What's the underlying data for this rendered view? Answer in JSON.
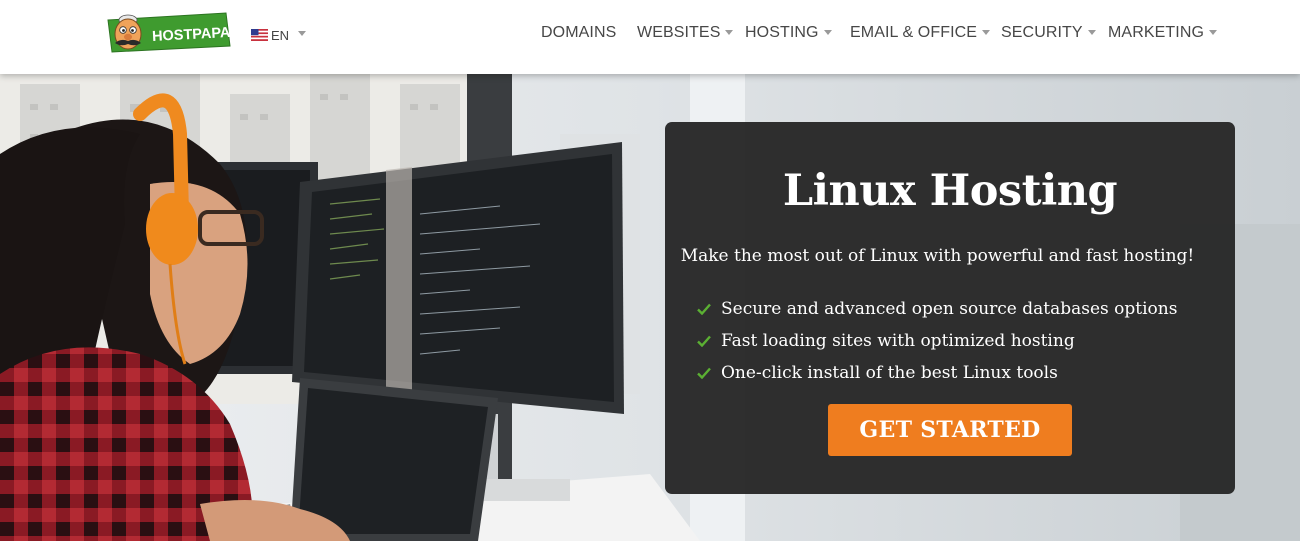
{
  "header": {
    "logo_text": "HOSTPAPA",
    "language": {
      "code": "EN",
      "flag": "us-flag-icon"
    },
    "nav": [
      {
        "label": "DOMAINS",
        "has_dropdown": false
      },
      {
        "label": "WEBSITES",
        "has_dropdown": true
      },
      {
        "label": "HOSTING",
        "has_dropdown": true
      },
      {
        "label": "EMAIL & OFFICE",
        "has_dropdown": true
      },
      {
        "label": "SECURITY",
        "has_dropdown": true
      },
      {
        "label": "MARKETING",
        "has_dropdown": true
      }
    ]
  },
  "hero": {
    "title": "Linux Hosting",
    "subtitle": "Make the most out of Linux with powerful and fast hosting!",
    "features": [
      "Secure and advanced open source databases options",
      "Fast loading sites with optimized hosting",
      "One-click install of the best Linux tools"
    ],
    "cta_label": "GET STARTED"
  },
  "colors": {
    "accent": "#ef7d1f",
    "brand_green": "#3f9b2f",
    "check_green": "#5bb033",
    "card_bg": "#282828",
    "nav_text": "#474747"
  }
}
